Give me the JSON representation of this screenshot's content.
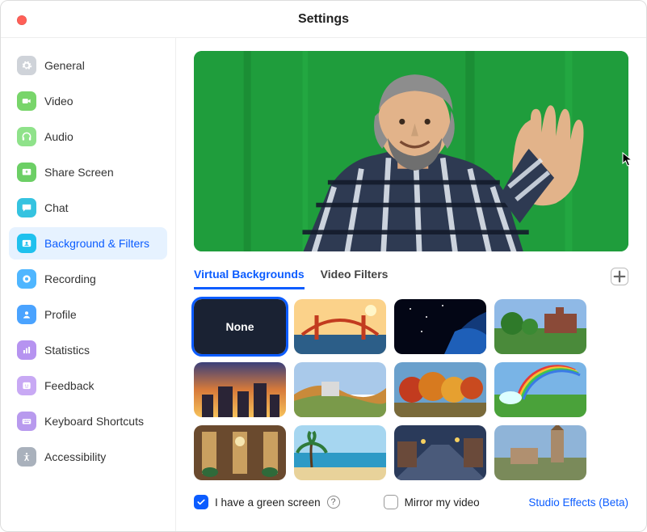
{
  "window_title": "Settings",
  "sidebar": {
    "items": [
      {
        "id": "general",
        "label": "General",
        "icon": "gear-icon",
        "color": "#cfd3d9",
        "active": false
      },
      {
        "id": "video",
        "label": "Video",
        "icon": "video-icon",
        "color": "#78d56a",
        "active": false
      },
      {
        "id": "audio",
        "label": "Audio",
        "icon": "headphones-icon",
        "color": "#8fe28a",
        "active": false
      },
      {
        "id": "share-screen",
        "label": "Share Screen",
        "icon": "share-screen-icon",
        "color": "#6ccf65",
        "active": false
      },
      {
        "id": "chat",
        "label": "Chat",
        "icon": "chat-icon",
        "color": "#35c3e0",
        "active": false
      },
      {
        "id": "background-filters",
        "label": "Background & Filters",
        "icon": "background-icon",
        "color": "#1fc1ee",
        "active": true
      },
      {
        "id": "recording",
        "label": "Recording",
        "icon": "record-icon",
        "color": "#4fb6ff",
        "active": false
      },
      {
        "id": "profile",
        "label": "Profile",
        "icon": "profile-icon",
        "color": "#4aa3ff",
        "active": false
      },
      {
        "id": "statistics",
        "label": "Statistics",
        "icon": "statistics-icon",
        "color": "#b693f0",
        "active": false
      },
      {
        "id": "feedback",
        "label": "Feedback",
        "icon": "feedback-icon",
        "color": "#c8a9f4",
        "active": false
      },
      {
        "id": "keyboard-shortcuts",
        "label": "Keyboard Shortcuts",
        "icon": "keyboard-icon",
        "color": "#b89aee",
        "active": false
      },
      {
        "id": "accessibility",
        "label": "Accessibility",
        "icon": "accessibility-icon",
        "color": "#a9b1bc",
        "active": false
      }
    ]
  },
  "tabs": [
    {
      "id": "virtual-backgrounds",
      "label": "Virtual Backgrounds",
      "active": true
    },
    {
      "id": "video-filters",
      "label": "Video Filters",
      "active": false
    }
  ],
  "add_button_label": "Add image or video",
  "backgrounds": [
    {
      "id": "none",
      "label": "None",
      "selected": true,
      "kind": "none"
    },
    {
      "id": "bridge",
      "label": "Golden Gate Bridge",
      "selected": false,
      "kind": "bridge"
    },
    {
      "id": "earth",
      "label": "Earth from space",
      "selected": false,
      "kind": "earth"
    },
    {
      "id": "campus",
      "label": "Campus lawn",
      "selected": false,
      "kind": "campus"
    },
    {
      "id": "sunset",
      "label": "City at sunset",
      "selected": false,
      "kind": "sunset"
    },
    {
      "id": "hills",
      "label": "Autumn hills",
      "selected": false,
      "kind": "hills"
    },
    {
      "id": "fall",
      "label": "Fall trees",
      "selected": false,
      "kind": "fall"
    },
    {
      "id": "rainbow",
      "label": "Rainbow field",
      "selected": false,
      "kind": "rainbow"
    },
    {
      "id": "lobby",
      "label": "Grand lobby",
      "selected": false,
      "kind": "lobby"
    },
    {
      "id": "beach",
      "label": "Tropical beach",
      "selected": false,
      "kind": "beach"
    },
    {
      "id": "street",
      "label": "Evening street",
      "selected": false,
      "kind": "street"
    },
    {
      "id": "tower",
      "label": "Clock tower",
      "selected": false,
      "kind": "tower"
    }
  ],
  "footer": {
    "greenscreen_label": "I have a green screen",
    "greenscreen_checked": true,
    "help_label": "?",
    "mirror_label": "Mirror my video",
    "mirror_checked": false,
    "studio_effects_label": "Studio Effects (Beta)"
  }
}
